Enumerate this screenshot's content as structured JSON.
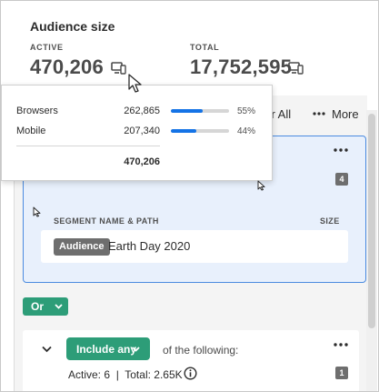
{
  "audience": {
    "title": "Audience size",
    "active_label": "ACTIVE",
    "active_value": "470,206",
    "total_label": "TOTAL",
    "total_value": "17,752,595"
  },
  "toolbar": {
    "clear_all_partial": "ear All",
    "more_icon": "more-dots-icon",
    "more_label": "More"
  },
  "segment_card": {
    "count": "4",
    "header_name": "SEGMENT NAME & PATH",
    "header_size": "SIZE",
    "row": {
      "badge": "Audience",
      "name": "Earth Day 2020"
    }
  },
  "or_button": {
    "label": "Or"
  },
  "group_card": {
    "include_label": "Include any",
    "following_text": "of the following:",
    "active_total": "Active: 6  |  Total: 2.65K",
    "count": "1"
  },
  "popover": {
    "rows": [
      {
        "label": "Browsers",
        "value": "262,865",
        "pct": "55%",
        "fill": 0.55
      },
      {
        "label": "Mobile",
        "value": "207,340",
        "pct": "44%",
        "fill": 0.44
      }
    ],
    "total": "470,206"
  },
  "colors": {
    "accent_green": "#2d9d78",
    "bar_blue": "#1473e6",
    "card_blue_bg": "#e8f0fc",
    "card_blue_border": "#4b8be0"
  }
}
